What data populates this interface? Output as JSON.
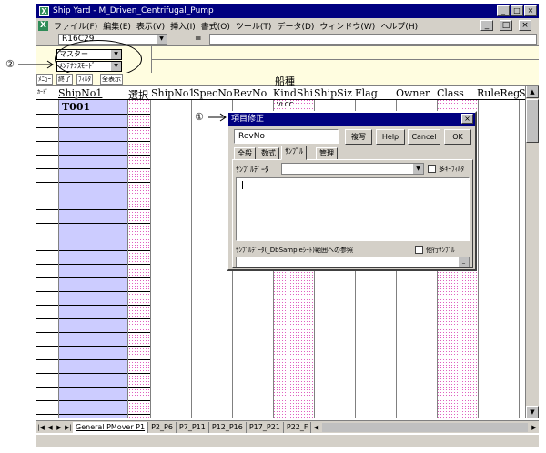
{
  "window": {
    "title": "Ship Yard - M_Driven_Centrifugal_Pump",
    "minimize": "_",
    "maximize": "□",
    "close": "×"
  },
  "menu": {
    "items": [
      "ファイル(F)",
      "編集(E)",
      "表示(V)",
      "挿入(I)",
      "書式(O)",
      "ツール(T)",
      "データ(D)",
      "ウィンドウ(W)",
      "ヘルプ(H)"
    ],
    "doc_buttons": [
      "_",
      "□",
      "×"
    ]
  },
  "formula": {
    "name_box": "R16C29",
    "equals": "="
  },
  "toolbar": {
    "dropdown1": "マスター",
    "dropdown2": "ﾒﾝﾃﾅﾝｽﾓｰﾄﾞ"
  },
  "callouts": {
    "one": "①",
    "two": "②"
  },
  "row2": {
    "buttons": [
      "ﾒﾆｭｰ",
      "終了",
      "ﾌｨﾙﾀ",
      "全表示"
    ],
    "group_label": "船種"
  },
  "headers": {
    "row_label": "ｶｰﾄﾞ",
    "columns": [
      "ShipNo1",
      "選択",
      "ShipNo1",
      "SpecNo",
      "RevNo",
      "KindShi",
      "ShipSiz",
      "Flag",
      "Owner",
      "Class",
      "RuleReg",
      "S"
    ]
  },
  "cells": {
    "first_value": "T001",
    "kind_value": "VLCC"
  },
  "sheets": {
    "tabs": [
      "General PMover P1",
      "P2_P6",
      "P7_P11",
      "P12_P16",
      "P17_P21",
      "P22_F"
    ]
  },
  "dialog": {
    "title": "項目修正",
    "field_value": "RevNo",
    "buttons": {
      "copy": "複写",
      "help": "Help",
      "cancel": "Cancel",
      "ok": "OK"
    },
    "tabs": [
      "全般",
      "数式",
      "ｻﾝﾌﾟﾙ",
      "管理"
    ],
    "sample_label": "ｻﾝﾌﾟﾙﾃﾞｰﾀ",
    "multi_key_label": "多ｷｰﾌｨﾙﾀ",
    "ref_label": "ｻﾝﾌﾟﾙﾃﾞｰﾀ(_DbSampleｼｰﾄ)範囲への参照",
    "other_row_label": "他行ｻﾝﾌﾟﾙ"
  }
}
